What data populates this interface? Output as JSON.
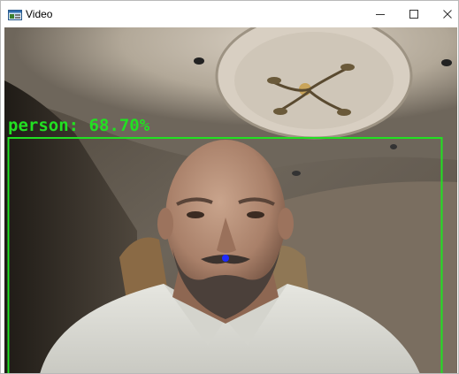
{
  "window": {
    "title": "Video",
    "icon": "app-window-icon",
    "controls": {
      "minimize_icon": "minimize-icon",
      "maximize_icon": "maximize-icon",
      "close_icon": "close-icon"
    }
  },
  "detection": {
    "label": "person: 68.70%",
    "box_color": "#22e022",
    "keypoint_color": "#1f2bff"
  }
}
